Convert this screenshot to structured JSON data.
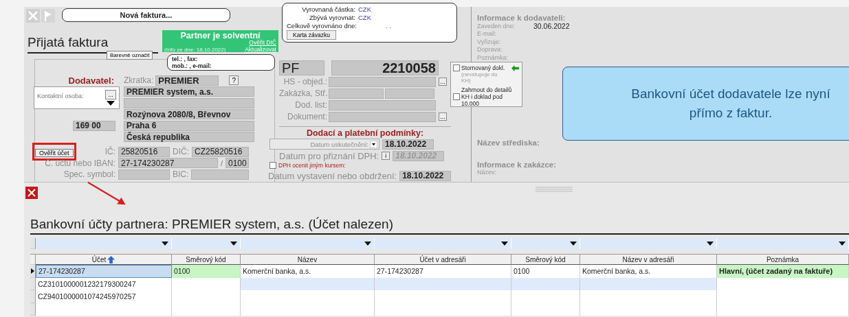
{
  "new_invoice_bubble": "Nová faktura...",
  "title": "Přijatá faktura",
  "solvency": {
    "status": "Partner je solventní",
    "info": "(Info ze dne: 18.10.2022)",
    "verify_link": "Ověřit DIČ",
    "update_link": "Aktualizovat"
  },
  "color_button": "Barevně označit",
  "contact_bubble": [
    "tel.: , fax:",
    "mob.: , e-mail:"
  ],
  "payment_bubble": {
    "rows": [
      {
        "label": "Vyrovnaná částka:",
        "value": "CZK"
      },
      {
        "label": "Zbývá vyrovnat:",
        "value": "CZK"
      },
      {
        "label": "Celkově vyrovnáno dne:",
        "value": ". ."
      }
    ],
    "button": "Karta závazku"
  },
  "supplier": {
    "label": "Dodavatel:",
    "contact_label": "Kontaktní osoba:",
    "contact_button": "...",
    "shortcut_label": "Zkratka:",
    "shortcut": "PREMIER",
    "help_button": "?",
    "name": "PREMIER system, a.s.",
    "address": "Rozýnova 2080/8, Břevnov",
    "zip": "169 00",
    "city": "Praha 6",
    "country": "Česká republika",
    "verify_button": "Ověřit účet",
    "verify_highlighted": true,
    "ic_label": "IČ:",
    "ic": "25820516",
    "dic_label": "DIČ:",
    "dic": "CZ25820516",
    "account_label": "Č. účtu nebo IBAN:",
    "account": "27-174230287",
    "bank_separator": "/",
    "bank_code": "0100",
    "symbol_label": "Spec. symbol:",
    "bic_label": "BIC:"
  },
  "document": {
    "series": "PF",
    "number": "2210058",
    "fields": [
      {
        "label": "HS - objed.:",
        "kind": "browse",
        "button": "..."
      },
      {
        "label": "Zakázka,  Stř.:",
        "kind": "split"
      },
      {
        "label": "Dod. list:",
        "kind": "plain"
      },
      {
        "label": "Dokument:",
        "kind": "browse",
        "button": "..."
      }
    ]
  },
  "terms": {
    "title": "Dodací a platební podmínky:",
    "date_select": "Datum uskutečnění:",
    "date": "18.10.2022",
    "vat_label": "Datum pro přiznání DPH:",
    "vat_button": "i",
    "vat_date": "18.10.2022",
    "other_rate": {
      "label": "DPH ocenit jiným kursem:",
      "checked": false
    },
    "issued_label": "Datum vystavení nebo obdržení:",
    "issued": "18.10.2022"
  },
  "flags": [
    {
      "label": "Stornovaný dokl.",
      "note": "(nevstupuje do KH)",
      "checked": false
    },
    {
      "label": "Zahrnout do detailů KH i doklad pod 10.000",
      "checked": false
    }
  ],
  "supplier_info": {
    "title": "Informace k dodavateli:",
    "rows": [
      {
        "label": "Zaveden dne:",
        "value": "30.06.2022"
      },
      {
        "label": "E-mail:"
      },
      {
        "label": "Vyřizuje:"
      },
      {
        "label": "Doprava:"
      },
      {
        "label": "Poznámka:"
      }
    ],
    "center_label": "Název střediska:",
    "order_title": "Informace k zakázce:",
    "order_rows": [
      "Název:"
    ]
  },
  "banner": [
    "Bankovní účet dodavatele lze nyní",
    "přímo z faktur."
  ],
  "accounts": {
    "title": "Bankovní účty partnera: PREMIER system, a.s. (Účet nalezen)",
    "columns": [
      {
        "label": "Účet",
        "sorted": true
      },
      {
        "label": "Směrový kód",
        "sorted": false
      },
      {
        "label": "Název",
        "sorted": false
      },
      {
        "label": "Účet v adresáři",
        "sorted": false
      },
      {
        "label": "Směrový kód",
        "sorted": false
      },
      {
        "label": "Název v adresáři",
        "sorted": false
      },
      {
        "label": "Poznámka",
        "sorted": false
      }
    ],
    "rows": [
      {
        "selected": true,
        "hovered": false,
        "cells": [
          {
            "text": "27-174230287",
            "matched": false
          },
          {
            "text": "0100",
            "matched": true
          },
          {
            "text": "Komerční banka, a.s.",
            "matched": false
          },
          {
            "text": "27-174230287",
            "matched": false
          },
          {
            "text": "0100",
            "matched": false
          },
          {
            "text": "Komerční banka, a.s.",
            "matched": false
          },
          {
            "text": "Hlavní, (účet zadaný na faktuře)",
            "matched": true
          }
        ]
      },
      {
        "selected": false,
        "hovered": true,
        "cells": [
          {
            "text": "CZ3101000001232179300247",
            "matched": false
          }
        ]
      },
      {
        "selected": false,
        "hovered": false,
        "cells": [
          {
            "text": "CZ9401000001074245970257",
            "matched": false
          }
        ]
      }
    ]
  }
}
